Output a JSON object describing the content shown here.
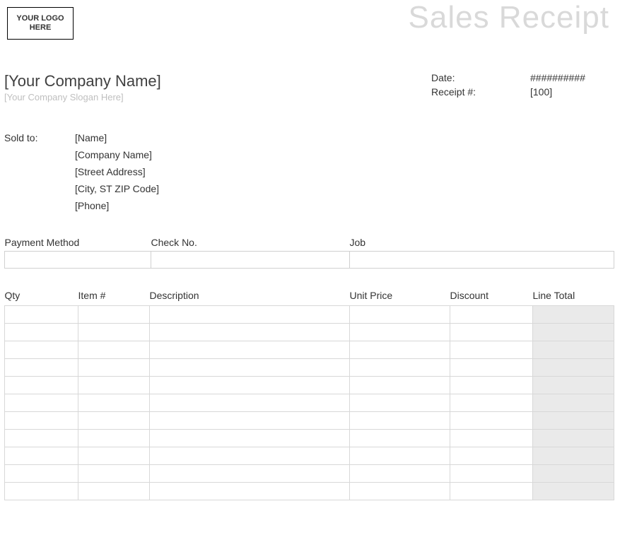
{
  "logo_text": "YOUR LOGO HERE",
  "title": "Sales Receipt",
  "company": {
    "name": "[Your Company Name]",
    "slogan": "[Your Company Slogan Here]"
  },
  "meta": {
    "date_label": "Date:",
    "date_value": "##########",
    "receipt_label": "Receipt #:",
    "receipt_value": "[100]"
  },
  "soldto": {
    "label": "Sold to:",
    "name": "[Name]",
    "company": "[Company Name]",
    "street": "[Street Address]",
    "city": "[City, ST  ZIP Code]",
    "phone": "[Phone]"
  },
  "payment": {
    "method_label": "Payment Method",
    "check_label": "Check No.",
    "job_label": "Job",
    "method_value": "",
    "check_value": "",
    "job_value": ""
  },
  "items_headers": {
    "qty": "Qty",
    "item": "Item #",
    "desc": "Description",
    "unit": "Unit Price",
    "disc": "Discount",
    "line": "Line Total"
  }
}
